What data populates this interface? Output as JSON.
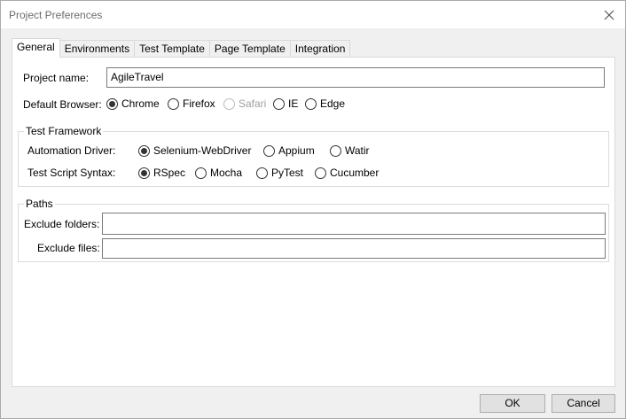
{
  "window": {
    "title": "Project Preferences"
  },
  "tabs": [
    {
      "label": "General",
      "active": true
    },
    {
      "label": "Environments",
      "active": false
    },
    {
      "label": "Test Template",
      "active": false
    },
    {
      "label": "Page Template",
      "active": false
    },
    {
      "label": "Integration",
      "active": false
    }
  ],
  "general": {
    "project_name_label": "Project name:",
    "project_name_value": "AgileTravel",
    "default_browser_label": "Default Browser:",
    "browsers": [
      {
        "label": "Chrome",
        "checked": true,
        "disabled": false
      },
      {
        "label": "Firefox",
        "checked": false,
        "disabled": false
      },
      {
        "label": "Safari",
        "checked": false,
        "disabled": true
      },
      {
        "label": "IE",
        "checked": false,
        "disabled": false
      },
      {
        "label": "Edge",
        "checked": false,
        "disabled": false
      }
    ]
  },
  "test_framework": {
    "title": "Test Framework",
    "automation_driver_label": "Automation Driver:",
    "drivers": [
      {
        "label": "Selenium-WebDriver",
        "checked": true
      },
      {
        "label": "Appium",
        "checked": false
      },
      {
        "label": "Watir",
        "checked": false
      }
    ],
    "syntax_label": "Test Script Syntax:",
    "syntaxes": [
      {
        "label": "RSpec",
        "checked": true
      },
      {
        "label": "Mocha",
        "checked": false
      },
      {
        "label": "PyTest",
        "checked": false
      },
      {
        "label": "Cucumber",
        "checked": false
      }
    ]
  },
  "paths": {
    "title": "Paths",
    "exclude_folders_label": "Exclude folders:",
    "exclude_folders_value": "",
    "exclude_files_label": "Exclude files:",
    "exclude_files_value": ""
  },
  "buttons": {
    "ok": "OK",
    "cancel": "Cancel"
  },
  "colors": {
    "window_bg": "#f0f0f0",
    "panel_bg": "#ffffff",
    "title_text": "#6d6d6d",
    "disabled_text": "#a0a0a0"
  }
}
